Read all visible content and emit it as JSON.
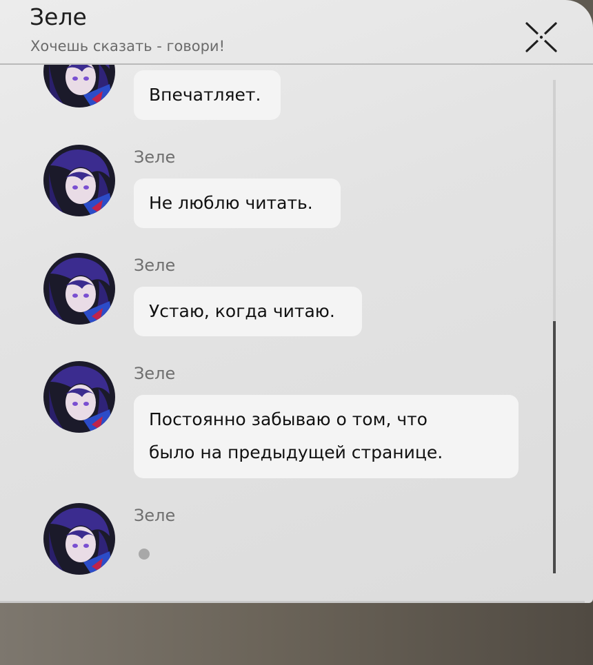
{
  "header": {
    "title": "Зеле",
    "subtitle": "Хочешь сказать - говори!",
    "close_icon": "close-x-icon"
  },
  "messages": [
    {
      "sender": "",
      "text": "Впечатляет."
    },
    {
      "sender": "Зеле",
      "text": "Не люблю читать."
    },
    {
      "sender": "Зеле",
      "text": "Устаю, когда читаю."
    },
    {
      "sender": "Зеле",
      "lines": [
        "Постоянно забываю о том, что",
        "было на предыдущей странице."
      ]
    },
    {
      "sender": "Зеле",
      "typing": true
    }
  ],
  "colors": {
    "panel": "#e6e6e6",
    "bubble": "#f4f4f4",
    "avatar_hair": "#3a2a8a",
    "avatar_accent": "#c0234a"
  }
}
